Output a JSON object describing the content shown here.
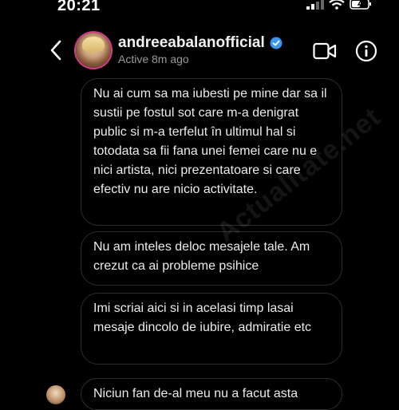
{
  "status_bar": {
    "time": "20:21"
  },
  "header": {
    "username": "andreeabalanofficial",
    "status": "Active 8m ago"
  },
  "messages": [
    "Nu ai cum sa ma iubesti pe mine dar sa il sustii pe fostul sot care m-a denigrat public si m-a terfelut în ultimul hal si totodata sa fii fana unei femei care nu e nici artista, nici prezentatoare si care efectiv nu are nicio activitate.",
    "Nu am inteles deloc mesajele tale. Am crezut ca ai probleme psihice",
    "Imi scriai aici si in acelasi timp lasai mesaje dincolo de iubire, admiratie etc",
    "Niciun fan de-al meu nu a facut asta"
  ],
  "watermark": "Actualitate.net",
  "colors": {
    "verified": "#3897f0",
    "bubble_border": "#2c2c2c",
    "background": "#000000"
  },
  "icons": [
    "back-arrow-icon",
    "verified-badge-icon",
    "video-call-icon",
    "info-icon",
    "signal-icon",
    "wifi-icon",
    "battery-icon"
  ]
}
